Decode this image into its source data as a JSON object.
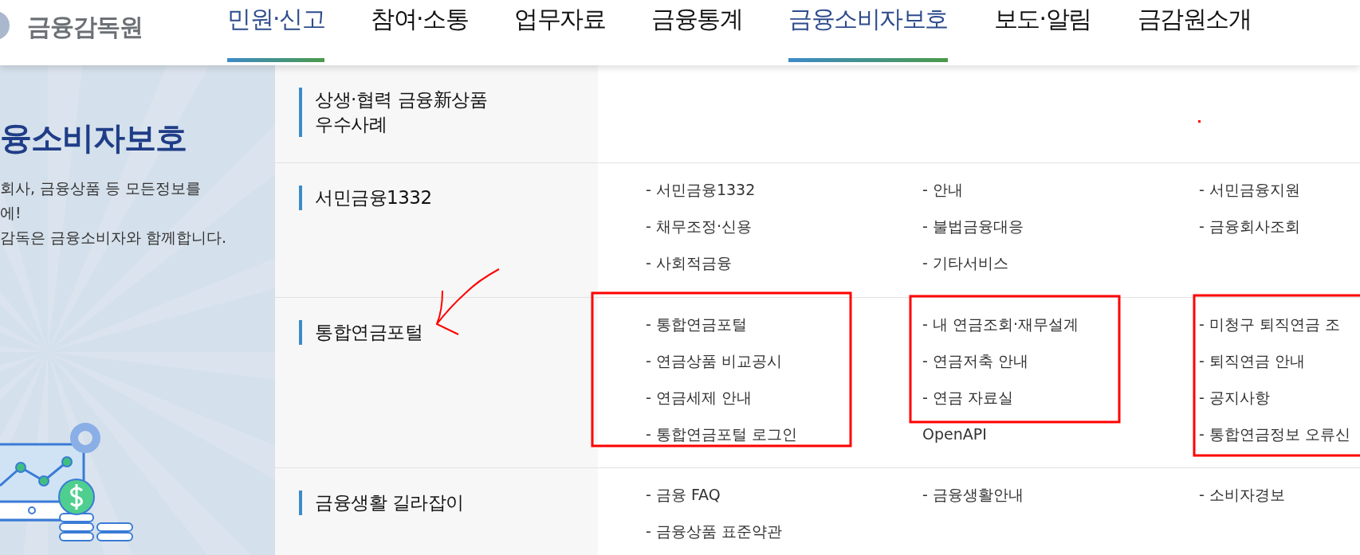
{
  "header": {
    "logo": "금융감독원",
    "nav": [
      {
        "label": "민원·신고",
        "selected": true
      },
      {
        "label": "참여·소통",
        "selected": false
      },
      {
        "label": "업무자료",
        "selected": false
      },
      {
        "label": "금융통계",
        "selected": false
      },
      {
        "label": "금융소비자보호",
        "selected": true
      },
      {
        "label": "보도·알림",
        "selected": false
      },
      {
        "label": "금감원소개",
        "selected": false
      }
    ]
  },
  "side": {
    "title": "융소비자보호",
    "lines": [
      "회사, 금융상품 등 모든정보를",
      "에!",
      "감독은 금융소비자와 함께합니다."
    ]
  },
  "sections": [
    {
      "title": "상생·협력 금융新상품 우수사례"
    },
    {
      "title": "서민금융1332",
      "columns": [
        [
          "- 서민금융1332",
          "- 채무조정·신용",
          "- 사회적금융"
        ],
        [
          "- 안내",
          "- 불법금융대응",
          "- 기타서비스"
        ],
        [
          "- 서민금융지원",
          "- 금융회사조회"
        ]
      ]
    },
    {
      "title": "통합연금포털",
      "columns": [
        [
          "- 통합연금포털",
          "- 연금상품 비교공시",
          "- 연금세제 안내",
          "- 통합연금포털 로그인"
        ],
        [
          "- 내 연금조회·재무설계",
          "- 연금저축 안내",
          "- 연금 자료실",
          "OpenAPI"
        ],
        [
          "- 미청구 퇴직연금 조",
          "- 퇴직연금 안내",
          "- 공지사항",
          "- 통합연금정보 오류신"
        ]
      ]
    },
    {
      "title": "금융생활 길라잡이",
      "columns": [
        [
          "- 금융 FAQ",
          "- 금융상품 표준약관"
        ],
        [
          "- 금융생활안내"
        ],
        [
          "- 소비자경보"
        ]
      ]
    }
  ]
}
